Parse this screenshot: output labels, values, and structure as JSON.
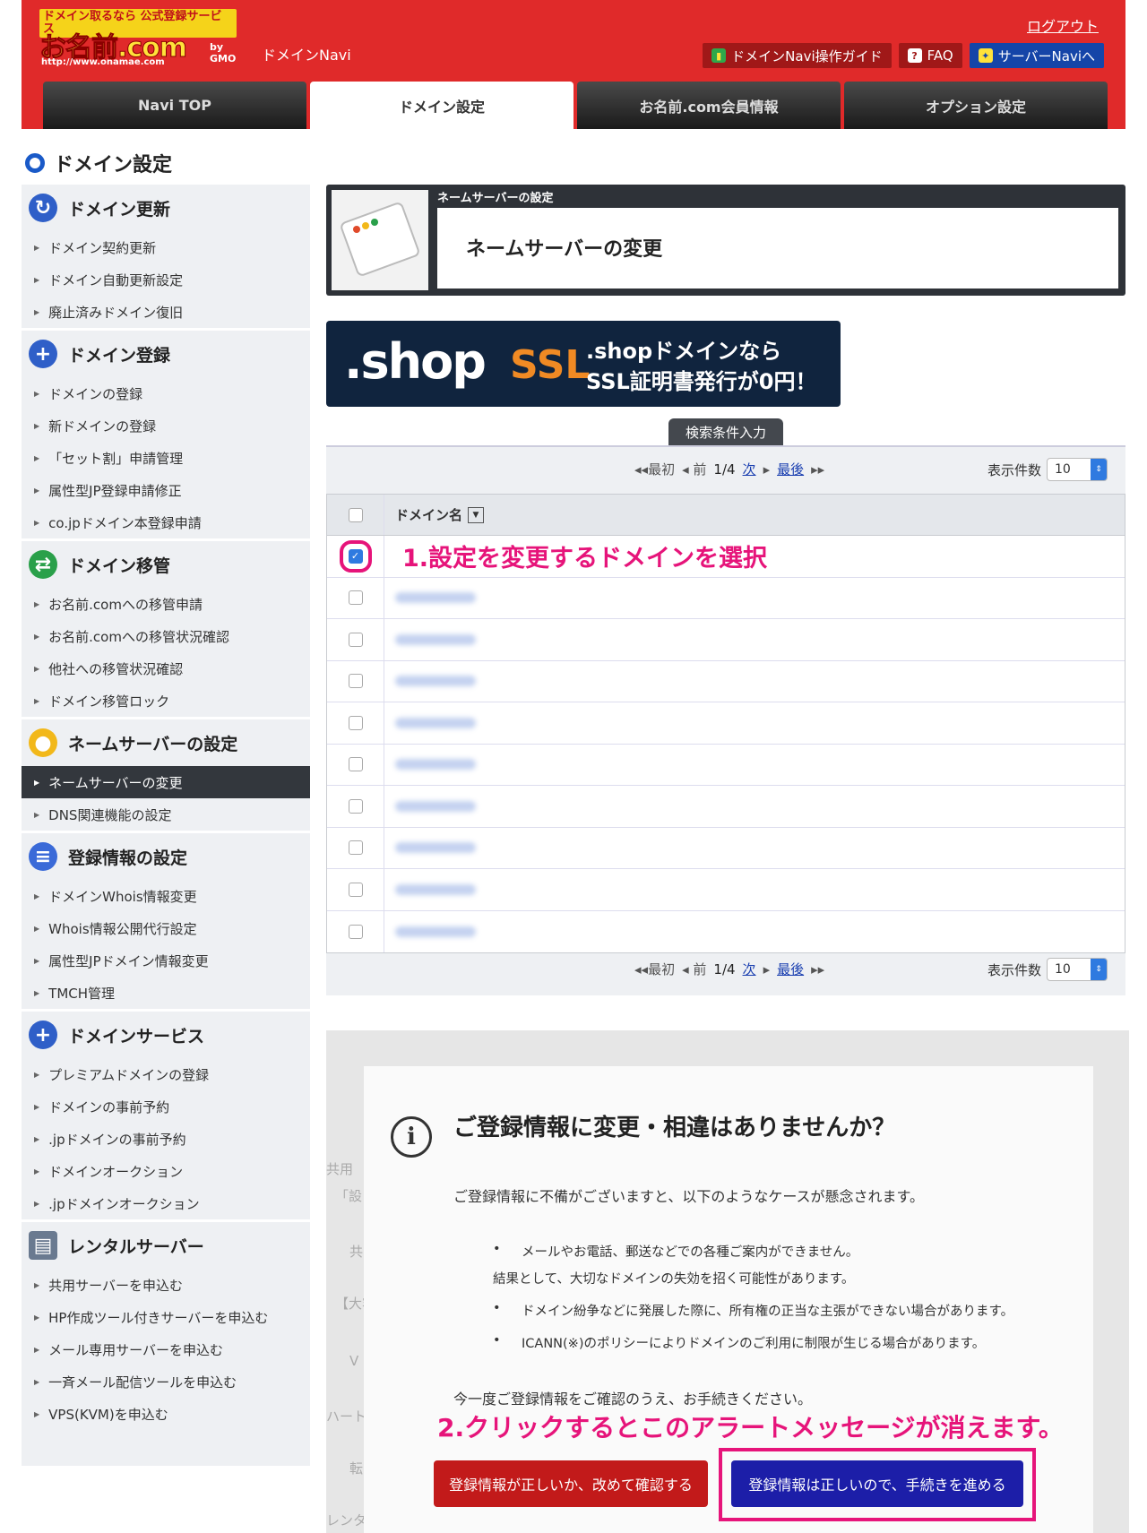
{
  "header": {
    "logo_top": "ドメイン取るなら 公式登録サービス",
    "logo_name": "お名前.com",
    "logo_gmo": "by GMO",
    "logo_url": "http://www.onamae.com",
    "app_name": "ドメインNavi",
    "logout": "ログアウト",
    "buttons": [
      "ドメインNavi操作ガイド",
      "FAQ",
      "サーバーNaviへ"
    ]
  },
  "tabs": [
    "Navi TOP",
    "ドメイン設定",
    "お名前.com会員情報",
    "オプション設定"
  ],
  "page_title": "ドメイン設定",
  "sidebar": [
    {
      "title": "ドメイン更新",
      "items": [
        "ドメイン契約更新",
        "ドメイン自動更新設定",
        "廃止済みドメイン復旧"
      ]
    },
    {
      "title": "ドメイン登録",
      "items": [
        "ドメインの登録",
        "新ドメインの登録",
        "「セット割」申請管理",
        "属性型JP登録申請修正",
        "co.jpドメイン本登録申請"
      ]
    },
    {
      "title": "ドメイン移管",
      "items": [
        "お名前.comへの移管申請",
        "お名前.comへの移管状況確認",
        "他社への移管状況確認",
        "ドメイン移管ロック"
      ]
    },
    {
      "title": "ネームサーバーの設定",
      "items": [
        "ネームサーバーの変更",
        "DNS関連機能の設定"
      ]
    },
    {
      "title": "登録情報の設定",
      "items": [
        "ドメインWhois情報変更",
        "Whois情報公開代行設定",
        "属性型JPドメイン情報変更",
        "TMCH管理"
      ]
    },
    {
      "title": "ドメインサービス",
      "items": [
        "プレミアムドメインの登録",
        "ドメインの事前予約",
        ".jpドメインの事前予約",
        "ドメインオークション",
        ".jpドメインオークション"
      ]
    },
    {
      "title": "レンタルサーバー",
      "items": [
        "共用サーバーを申込む",
        "HP作成ツール付きサーバーを申込む",
        "メール専用サーバーを申込む",
        "一斉メール配信ツールを申込む",
        "VPS(KVM)を申込む"
      ]
    }
  ],
  "ns_box": {
    "subtitle": "ネームサーバーの設定",
    "title": "ネームサーバーの変更"
  },
  "banner": {
    "shop": ".shop",
    "ssl": "SSL",
    "line1": ".shopドメインなら",
    "line2": "SSL証明書発行が0円！"
  },
  "search_tab": "検索条件入力",
  "pager": {
    "first": "最初",
    "prev": "前",
    "page": "1/4",
    "next": "次",
    "last": "最後",
    "per_page_label": "表示件数",
    "per_page": "10"
  },
  "table": {
    "column": "ドメイン名",
    "annotation": "1.設定を変更するドメインを選択"
  },
  "dialog": {
    "title": "ご登録情報に変更・相違はありませんか？",
    "intro": "ご登録情報に不備がございますと、以下のようなケースが懸念されます。",
    "b1": "メールやお電話、郵送などでの各種ご案内ができません。",
    "b1_cont": "結果として、大切なドメインの失効を招く可能性があります。",
    "b2": "ドメイン紛争などに発展した際に、所有権の正当な主張ができない場合があります。",
    "b3": "ICANN(※)のポリシーによりドメインのご利用に制限が生じる場合があります。",
    "outro": "今一度ご登録情報をご確認のうえ、お手続きください。",
    "btn_recheck": "登録情報が正しいか、改めて確認する",
    "btn_proceed": "登録情報は正しいので、手続きを進める"
  },
  "annotation2": "2.クリックするとこのアラートメッセージが消えます。",
  "ghost": [
    "共用",
    "「設",
    "共",
    "【大容",
    "V",
    "ハート",
    "転",
    "レンタ"
  ]
}
